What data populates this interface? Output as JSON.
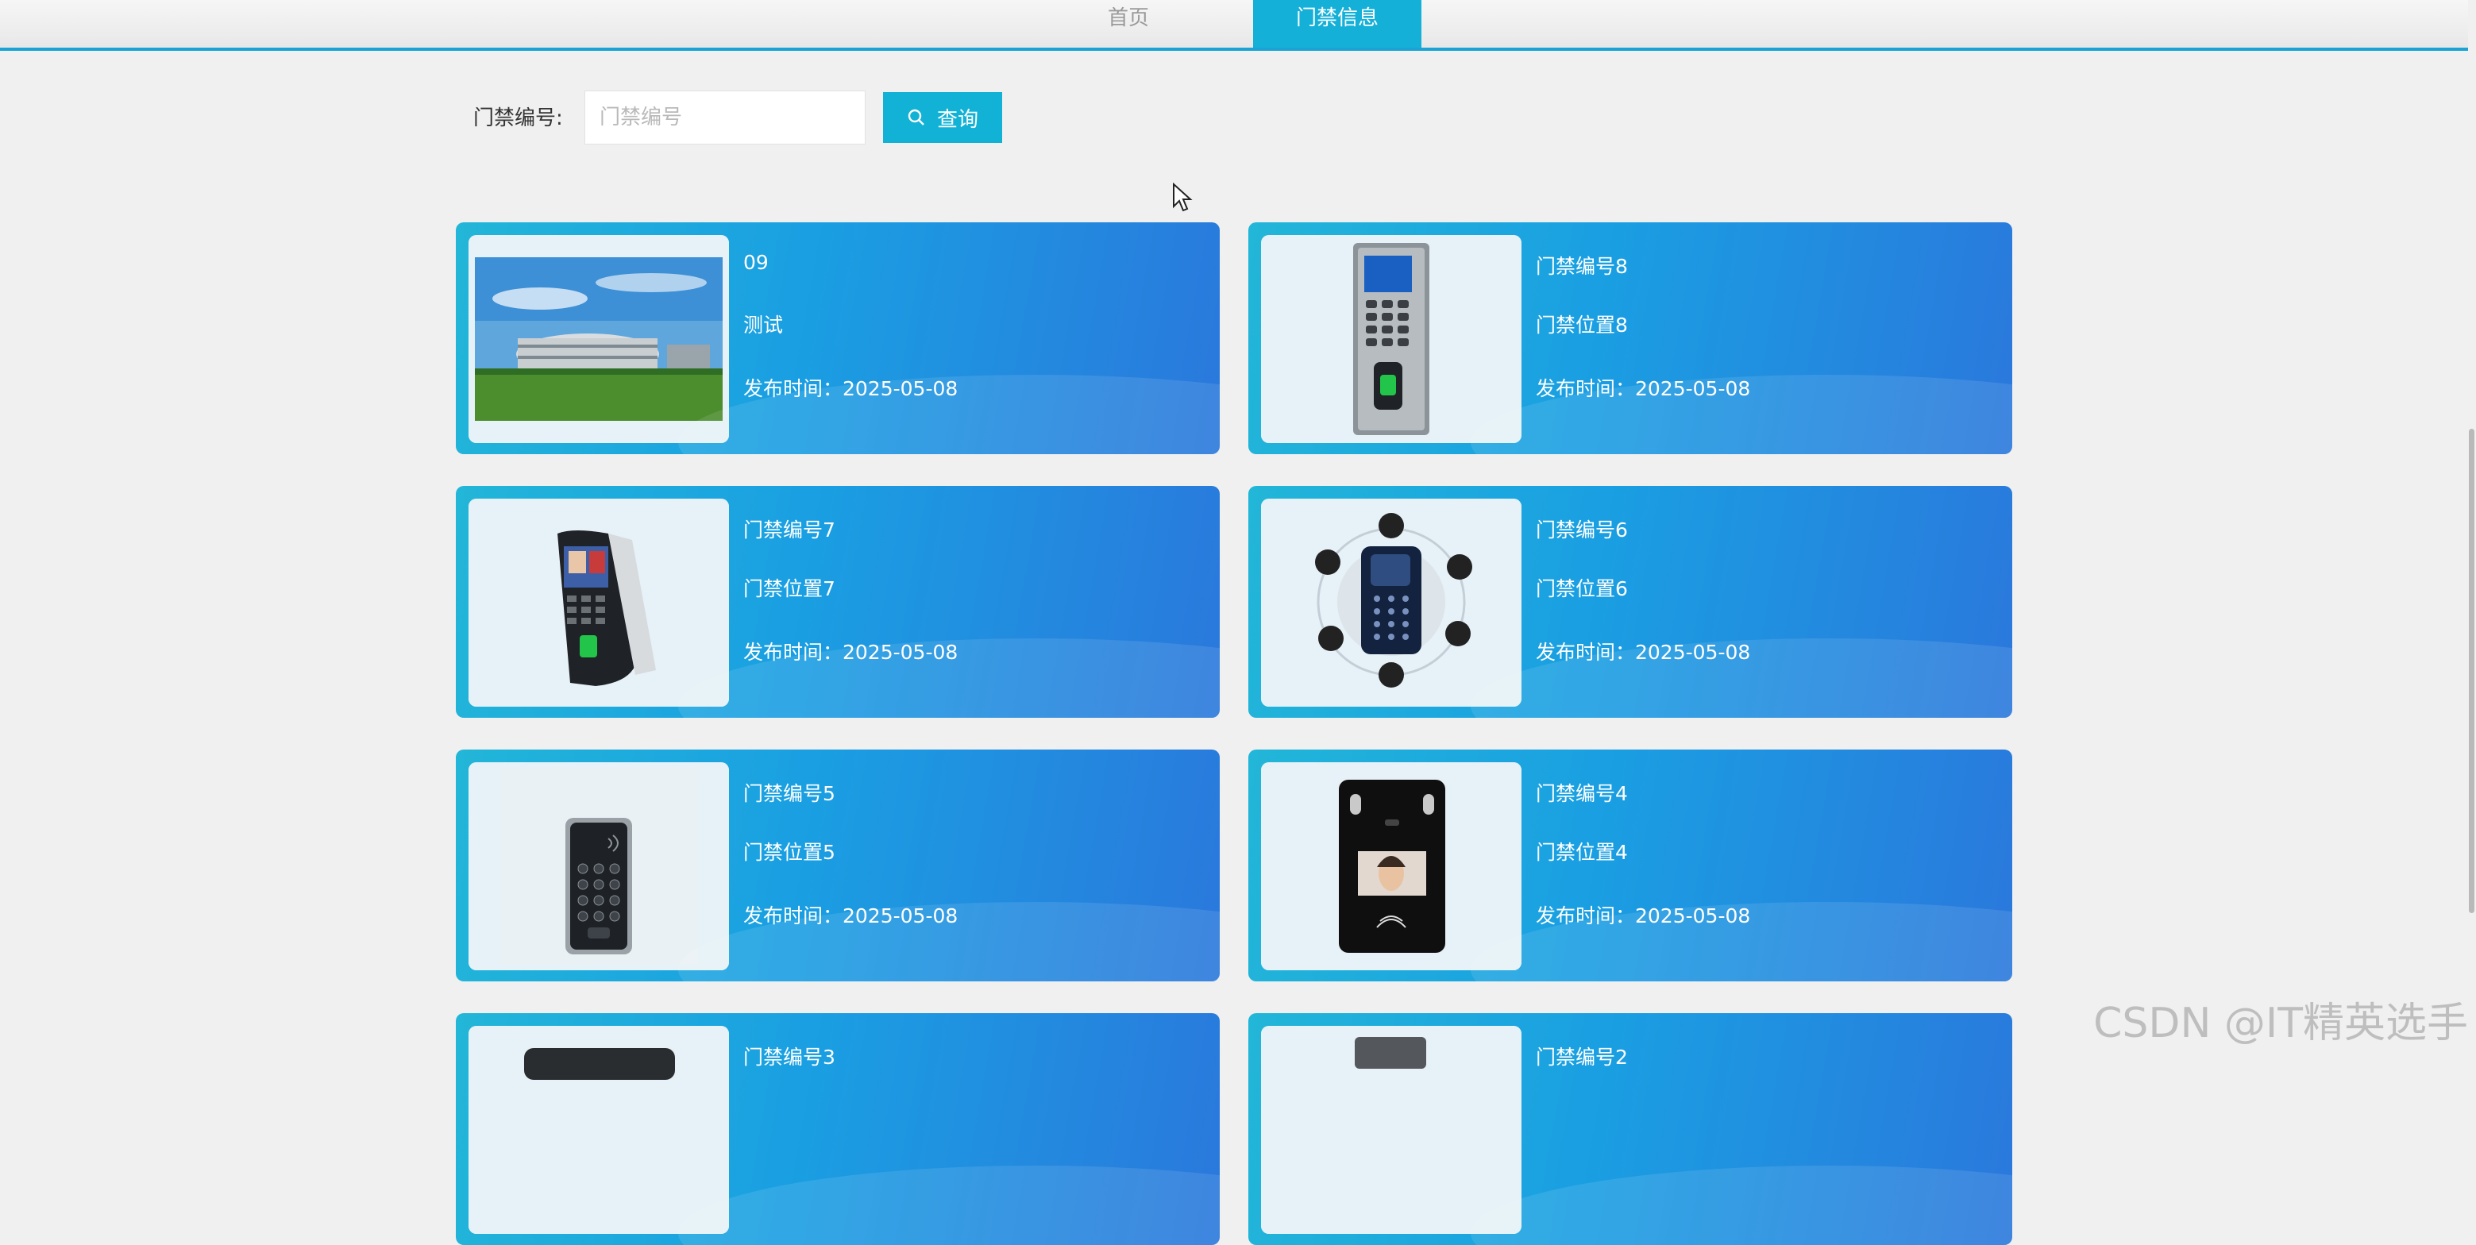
{
  "nav": {
    "home_label": "首页",
    "active_label": "门禁信息"
  },
  "search": {
    "label": "门禁编号:",
    "placeholder": "门禁编号",
    "button_label": "查询"
  },
  "cards": [
    {
      "title": "09",
      "subtitle": "测试",
      "date": "发布时间：2025-05-08",
      "image": "building-photo"
    },
    {
      "title": "门禁编号8",
      "subtitle": "门禁位置8",
      "date": "发布时间：2025-05-08",
      "image": "keypad-fingerprint-terminal"
    },
    {
      "title": "门禁编号7",
      "subtitle": "门禁位置7",
      "date": "发布时间：2025-05-08",
      "image": "face-fingerprint-terminal"
    },
    {
      "title": "门禁编号6",
      "subtitle": "门禁位置6",
      "date": "发布时间：2025-05-08",
      "image": "card-reader-feature-diagram"
    },
    {
      "title": "门禁编号5",
      "subtitle": "门禁位置5",
      "date": "发布时间：2025-05-08",
      "image": "keypad-card-reader"
    },
    {
      "title": "门禁编号4",
      "subtitle": "门禁位置4",
      "date": "发布时间：2025-05-08",
      "image": "face-recognition-panel"
    },
    {
      "title": "门禁编号3",
      "subtitle": "",
      "date": "",
      "image": "device"
    },
    {
      "title": "门禁编号2",
      "subtitle": "",
      "date": "",
      "image": "device"
    }
  ],
  "watermark": "CSDN @IT精英选手"
}
